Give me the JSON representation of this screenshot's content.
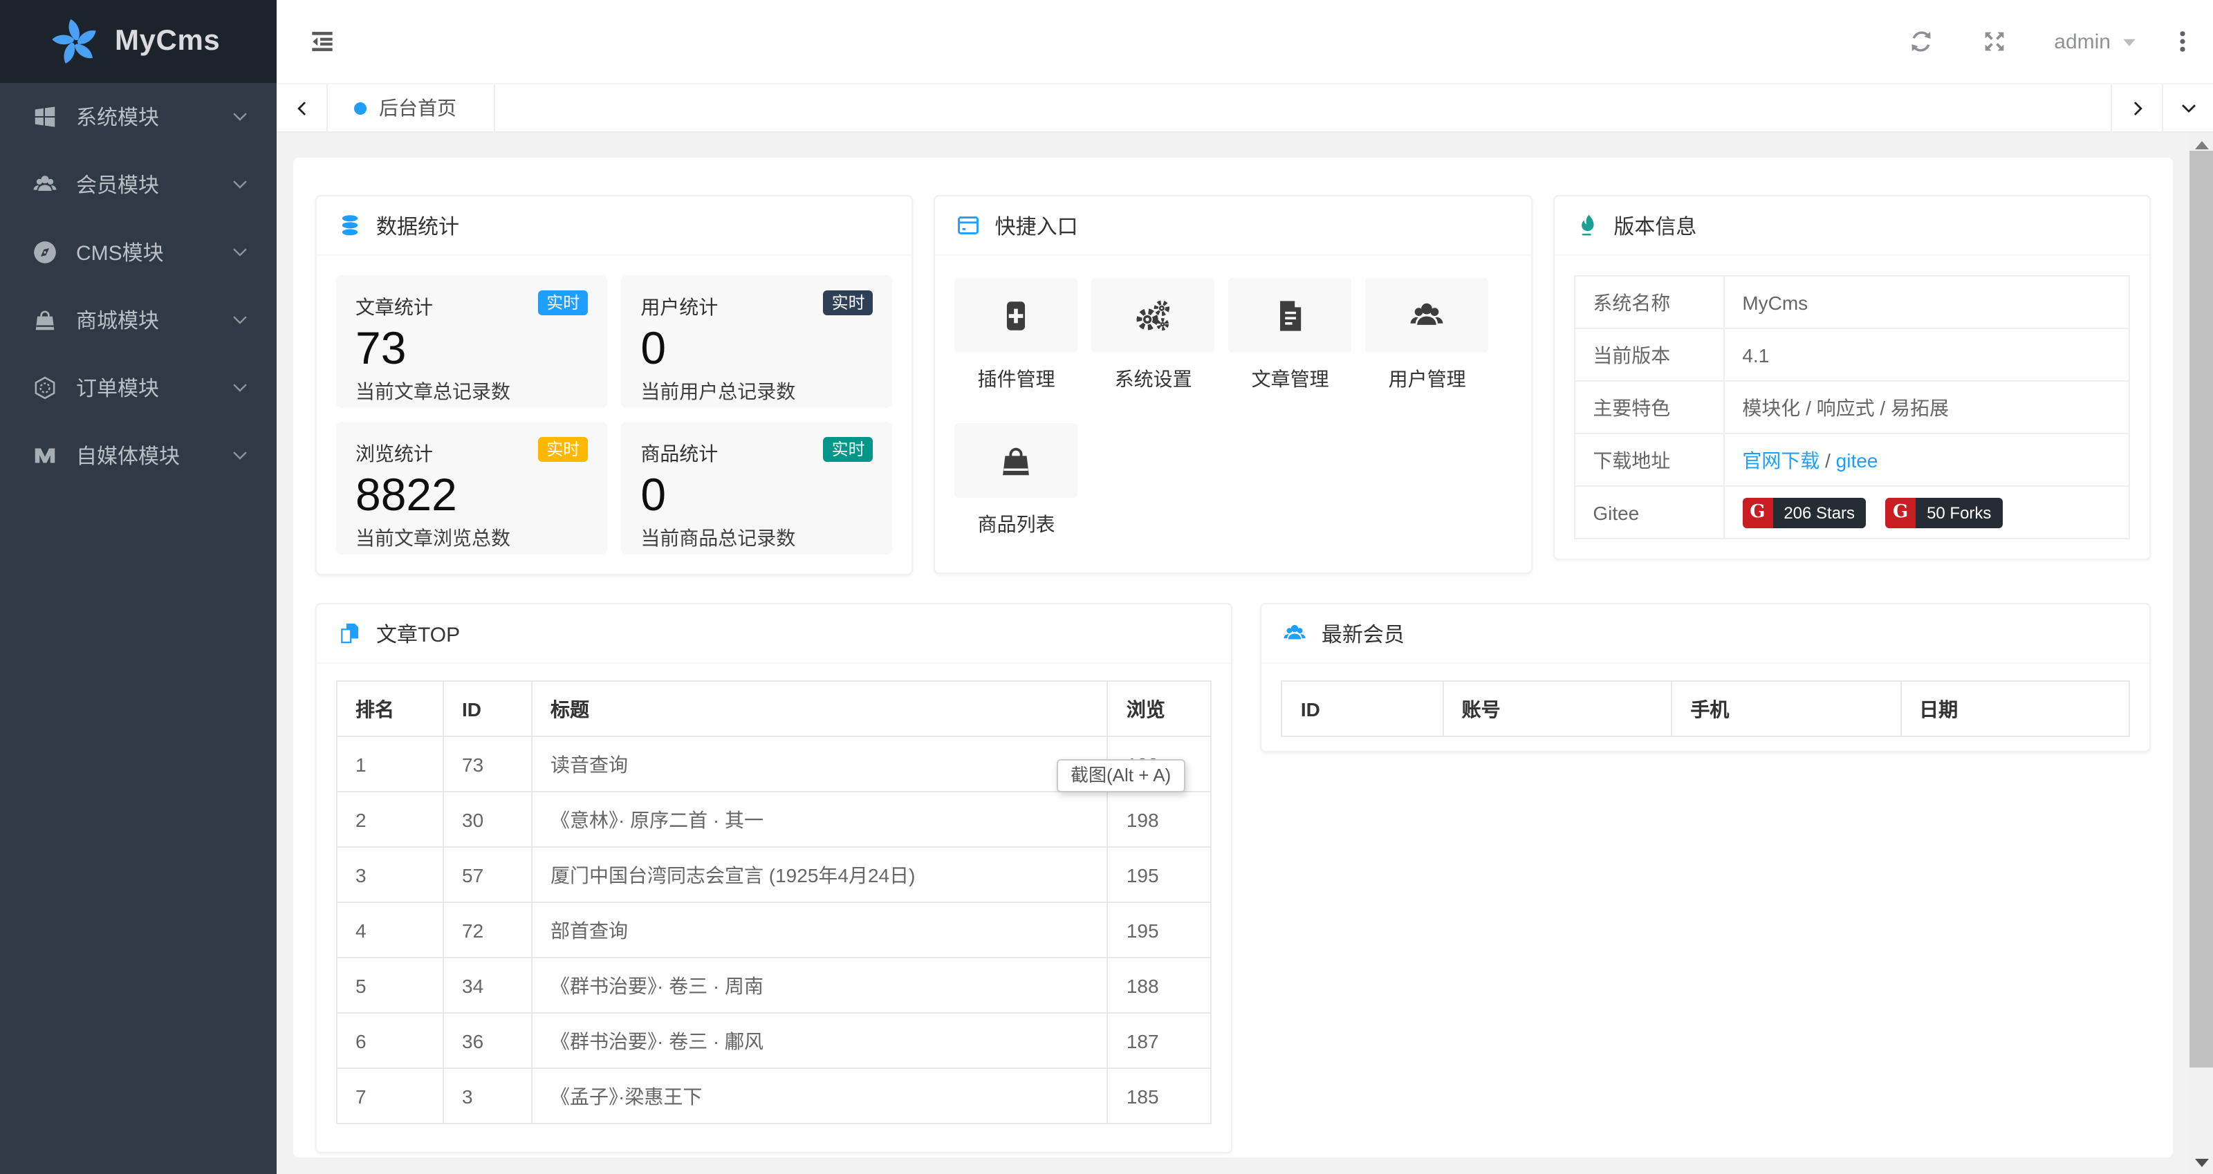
{
  "app": {
    "name": "MyCms"
  },
  "colors": {
    "accent": "#1E9FFF",
    "badge_dark": "#2F4056",
    "badge_yellow": "#FFB800",
    "badge_green": "#009688",
    "version_icon_teal": "#1aa094",
    "gitee_red": "#C71D23"
  },
  "sidebar": {
    "items": [
      {
        "label": "系统模块",
        "icon": "windows-icon"
      },
      {
        "label": "会员模块",
        "icon": "users-icon"
      },
      {
        "label": "CMS模块",
        "icon": "cms-compass-icon"
      },
      {
        "label": "商城模块",
        "icon": "shopping-bag-icon"
      },
      {
        "label": "订单模块",
        "icon": "hexagon-order-icon"
      },
      {
        "label": "自媒体模块",
        "icon": "media-m-icon"
      }
    ]
  },
  "topbar": {
    "username": "admin"
  },
  "tabs": {
    "active": "后台首页"
  },
  "cards": {
    "stats": {
      "title": "数据统计",
      "items": [
        {
          "label": "文章统计",
          "badge": "实时",
          "badge_color": "#1E9FFF",
          "value": "73",
          "caption": "当前文章总记录数"
        },
        {
          "label": "用户统计",
          "badge": "实时",
          "badge_color": "#2F4056",
          "value": "0",
          "caption": "当前用户总记录数"
        },
        {
          "label": "浏览统计",
          "badge": "实时",
          "badge_color": "#FFB800",
          "value": "8822",
          "caption": "当前文章浏览总数"
        },
        {
          "label": "商品统计",
          "badge": "实时",
          "badge_color": "#009688",
          "value": "0",
          "caption": "当前商品总记录数"
        }
      ]
    },
    "quick": {
      "title": "快捷入口",
      "items": [
        {
          "label": "插件管理",
          "icon": "plus-square-icon"
        },
        {
          "label": "系统设置",
          "icon": "gears-icon"
        },
        {
          "label": "文章管理",
          "icon": "document-icon"
        },
        {
          "label": "用户管理",
          "icon": "users-icon"
        },
        {
          "label": "商品列表",
          "icon": "shopping-bag-icon"
        }
      ]
    },
    "version": {
      "title": "版本信息",
      "rows": [
        {
          "label": "系统名称",
          "value": "MyCms"
        },
        {
          "label": "当前版本",
          "value": "4.1"
        },
        {
          "label": "主要特色",
          "value": "模块化 / 响应式 / 易拓展"
        }
      ],
      "download": {
        "label": "下载地址",
        "link1": "官网下载",
        "sep": " / ",
        "link2": "gitee"
      },
      "gitee": {
        "label": "Gitee",
        "badges": [
          {
            "logo": "G",
            "text": "206 Stars"
          },
          {
            "logo": "G",
            "text": "50 Forks"
          }
        ]
      }
    },
    "articles": {
      "title": "文章TOP",
      "headers": [
        "排名",
        "ID",
        "标题",
        "浏览"
      ],
      "rows": [
        [
          "1",
          "73",
          "读音查询",
          "199"
        ],
        [
          "2",
          "30",
          "《意林》· 原序二首 · 其一",
          "198"
        ],
        [
          "3",
          "57",
          "厦门中国台湾同志会宣言 (1925年4月24日)",
          "195"
        ],
        [
          "4",
          "72",
          "部首查询",
          "195"
        ],
        [
          "5",
          "34",
          "《群书治要》· 卷三 · 周南",
          "188"
        ],
        [
          "6",
          "36",
          "《群书治要》· 卷三 · 鄘风",
          "187"
        ],
        [
          "7",
          "3",
          "《孟子》·梁惠王下",
          "185"
        ]
      ]
    },
    "members": {
      "title": "最新会员",
      "headers": [
        "ID",
        "账号",
        "手机",
        "日期"
      ],
      "rows": []
    }
  },
  "tooltip": {
    "text": "截图(Alt + A)"
  }
}
